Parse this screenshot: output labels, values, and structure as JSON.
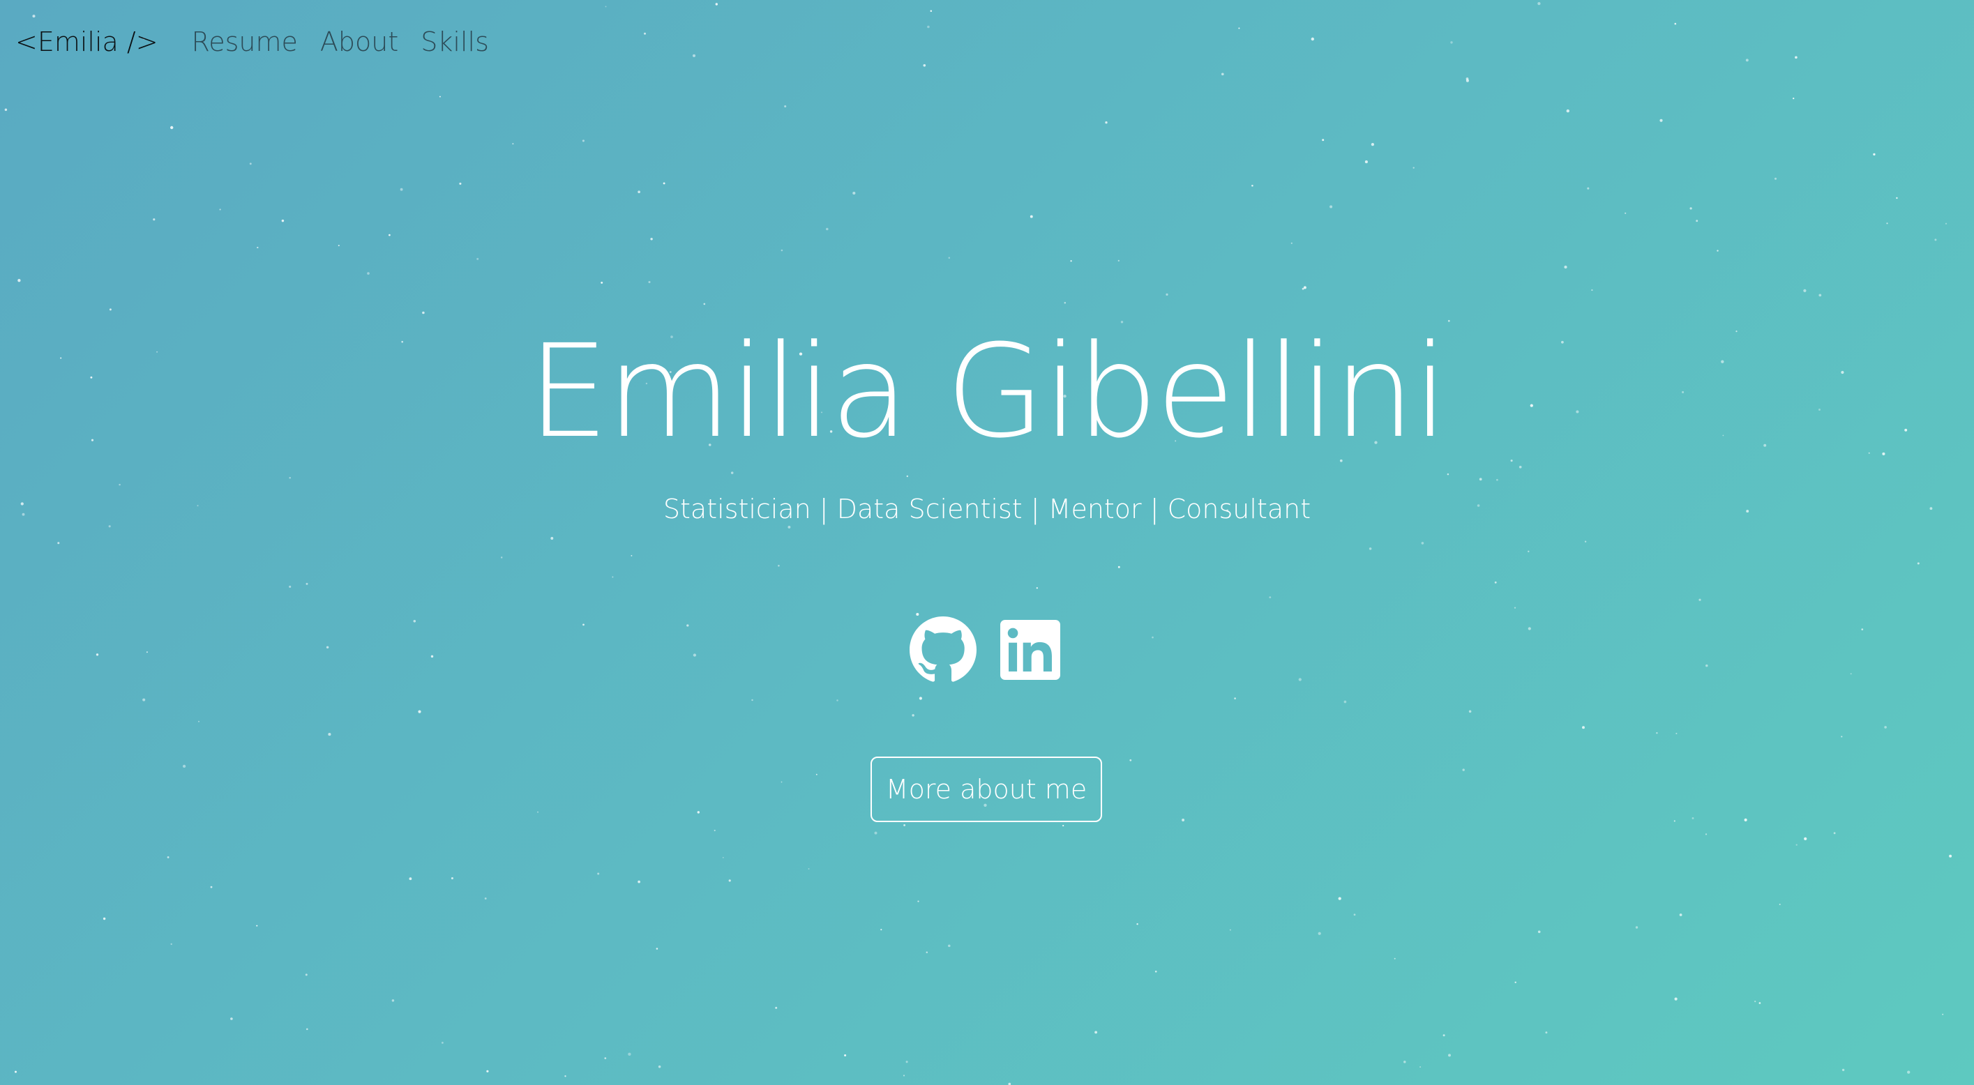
{
  "navbar": {
    "brand": "<Emilia />",
    "items": [
      {
        "label": "Resume"
      },
      {
        "label": "About"
      },
      {
        "label": "Skills"
      }
    ]
  },
  "hero": {
    "name": "Emilia Gibellini",
    "tagline": "Statistician | Data Scientist | Mentor | Consultant",
    "socials": [
      {
        "icon": "github-icon"
      },
      {
        "icon": "linkedin-icon"
      }
    ],
    "cta_label": "More about me"
  },
  "colors": {
    "gradient_start": "#5aaac2",
    "gradient_end": "#5ec9c0",
    "text": "#ffffff",
    "brand_text": "#0b1114",
    "nav_text": "#2c4b57"
  }
}
